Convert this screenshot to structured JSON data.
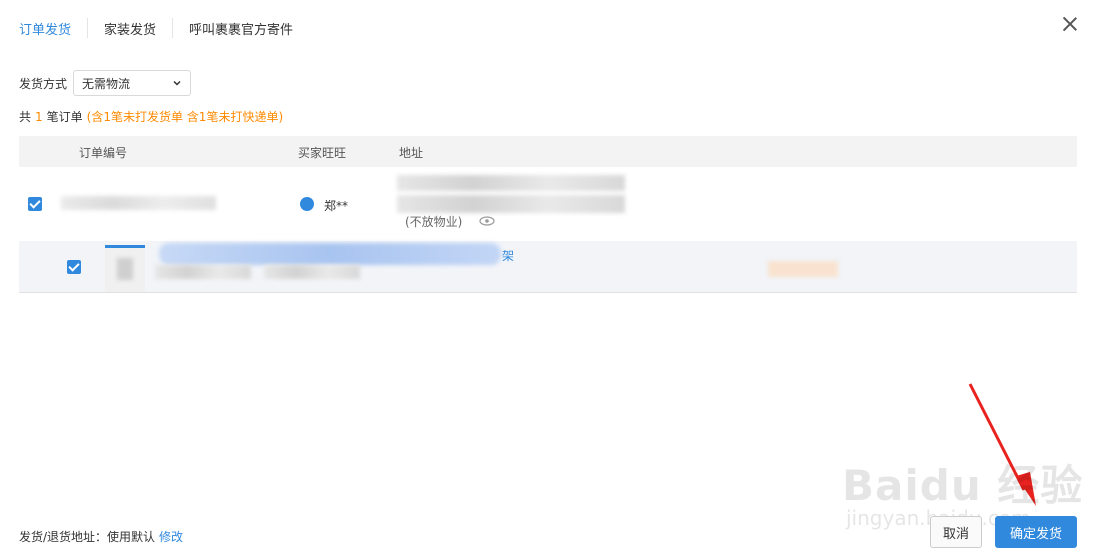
{
  "tabs": [
    {
      "label": "订单发货",
      "active": true
    },
    {
      "label": "家装发货",
      "active": false
    },
    {
      "label": "呼叫裹裹官方寄件",
      "active": false
    }
  ],
  "shipping": {
    "label": "发货方式",
    "selected": "无需物流"
  },
  "summary": {
    "prefix": "共",
    "count": "1",
    "suffix": "笔订单",
    "warning": "(含1笔未打发货单 含1笔未打快递单)"
  },
  "table": {
    "headers": [
      "订单编号",
      "买家旺旺",
      "地址"
    ],
    "row1": {
      "checked": true,
      "buyer": "郑**",
      "address_note": "(不放物业)"
    },
    "row2": {
      "checked": true,
      "link_tail": "架"
    }
  },
  "footer": {
    "address_text": "发货/退货地址：使用默认",
    "modify_label": "修改",
    "cancel_label": "取消",
    "confirm_label": "确定发货"
  },
  "watermark": {
    "main": "Baidu 经验",
    "sub": "jingyan.baidu.com"
  },
  "colors": {
    "accent": "#3089dc",
    "warning": "#ff8a00",
    "annotation_arrow": "#e8231f"
  }
}
